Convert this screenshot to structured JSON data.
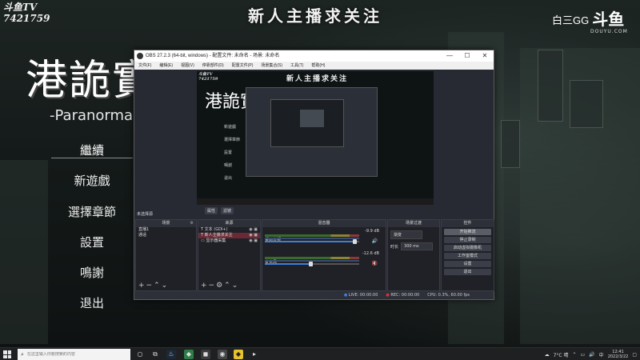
{
  "overlay": {
    "streamer_tag_1": "斗鱼TV",
    "streamer_tag_2": "7421759",
    "follow_banner": "新人主播求关注",
    "douyu_uid": "白三GG",
    "douyu_logo": "斗鱼",
    "douyu_domain": "DOUYU.COM"
  },
  "game": {
    "title": "港詭實",
    "subtitle": "-Paranorma",
    "menu": [
      "繼續",
      "新遊戲",
      "選擇章節",
      "設置",
      "鳴謝",
      "退出"
    ]
  },
  "obs": {
    "title": "OBS 27.2.3 (64-bit, windows) - 配置文件: 未命名 - 场景: 未命名",
    "window_controls": [
      "—",
      "☐",
      "✕"
    ],
    "menu": [
      "文件(F)",
      "编辑(E)",
      "视图(V)",
      "停靠部件(D)",
      "配置文件(P)",
      "场景集合(S)",
      "工具(T)",
      "帮助(H)"
    ],
    "preview": {
      "tag_1": "斗鱼TV",
      "tag_2": "7421759",
      "banner": "新人主播求关注",
      "title": "港詭實",
      "menu": [
        "繼續",
        "新遊戲",
        "選擇章節",
        "設置",
        "鳴謝",
        "退出"
      ]
    },
    "toolbar": [
      "属性",
      "滤镜"
    ],
    "scene_label": "未选择源",
    "docks": {
      "scenes": {
        "title": "场景",
        "items": [
          "直播1",
          "通话"
        ]
      },
      "sources": {
        "title": "来源",
        "items": [
          {
            "type": "T",
            "name": "文本 (GDI+)"
          },
          {
            "type": "T",
            "name": "新人主播求关注"
          },
          {
            "type": "▭",
            "name": "显示器采集"
          }
        ]
      },
      "mixer": {
        "title": "混音器",
        "channels": [
          {
            "name": "桌面音频",
            "db": "-9.9 dB",
            "level": 0.68,
            "volume": 0.95,
            "muted": false
          },
          {
            "name": "麦克风",
            "db": "-12.6 dB",
            "level": 0.55,
            "volume": 0.48,
            "muted": true
          }
        ]
      },
      "transitions": {
        "title": "场景过渡",
        "type_label": "渐变",
        "duration_label": "时长",
        "duration_value": "300 ms"
      },
      "controls": {
        "title": "控件",
        "buttons": [
          "开始推流",
          "停止录制",
          "启动虚拟摄像机",
          "工作室模式",
          "设置",
          "退出"
        ]
      }
    },
    "status": {
      "live_label": "LIVE:",
      "live_time": "00:00:00",
      "rec_label": "REC:",
      "rec_time": "00:00:00",
      "cpu": "CPU: 0.3%, 60.00 fps"
    }
  },
  "taskbar": {
    "search_placeholder": "在这里输入你要搜索的内容",
    "tray_weather": "7°C 晴",
    "tray_lang": "中",
    "time": "12:41",
    "date": "2022/3/22"
  }
}
